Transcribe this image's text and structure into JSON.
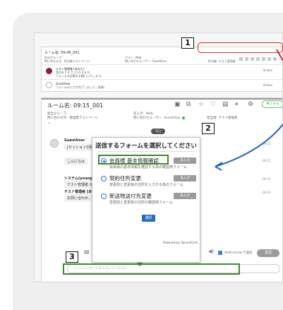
{
  "callouts": {
    "one": "1",
    "two": "2",
    "three": "3"
  },
  "mini": {
    "room": "ルーム名: 09:46_001",
    "group": "担当グループ：",
    "from": "問い合わせ元：担当者テストページ",
    "guest_label": "ゲスト: Web",
    "guest_user": "問い合わせユーザー: GuestUser",
    "owner": "担当者: テスト管理者",
    "msg1_name": "テスト管理者 [あなた]",
    "msg1_text": "案内をさせていただきます。",
    "msg1_text2": "フォームの記載をお願いいたします。",
    "msg2_name": "GuestUser",
    "msg2_text": "フォームの入力が完了しました（画像）",
    "time": "Online"
  },
  "main": {
    "room_title": "ルーム名: 09:15_001",
    "group": "担当グループ：",
    "from": "問い合わせ元：管理者テストページ",
    "guest_label": "非入元：Web",
    "guest_user": "問い合わせユーザー: GuestUser",
    "owner": "担当者: テスト管理者",
    "end_button": "終了する",
    "date_pill": "今日",
    "messages": [
      {
        "name": "GuestUser",
        "text": "[セッションが開始しました]",
        "time": "09:15"
      },
      {
        "name": "",
        "text": "こんにちは",
        "time": "09:15"
      },
      {
        "name": "システム(youngfles)",
        "text": "テスト管理者 が入室しました",
        "time": "09:15"
      },
      {
        "name": "テスト管理者 [あなた]",
        "text": "お問い合わせ、ありがとうございます。",
        "time": "09:16"
      }
    ],
    "shift_enter": "Shift+Enterで送信",
    "send": "送信",
    "input_placeholder": "ここにメッセージを入力してください"
  },
  "popup": {
    "title": "送信するフォームを選択してください",
    "options": [
      {
        "label": "会員様 基本情報確認",
        "desc": "会員様の基本情報を確認する為の確認用フォーム",
        "badge": "未入力"
      },
      {
        "label": "契約住所変更",
        "desc": "変更前と変更後の住所を入力する為のフォーム",
        "badge": "未入力"
      },
      {
        "label": "新送物送付先変更",
        "desc": "変更前と変更後の住所の確認用フォーム",
        "badge": "未入力"
      }
    ],
    "select_button": "選択",
    "powered": "Powered by: SecureForm"
  },
  "colors": {
    "accent_green": "#3b8a2c",
    "accent_blue": "#1f5fd0",
    "accent_red": "#d22b2b",
    "avatar": "#8c1b4e"
  }
}
